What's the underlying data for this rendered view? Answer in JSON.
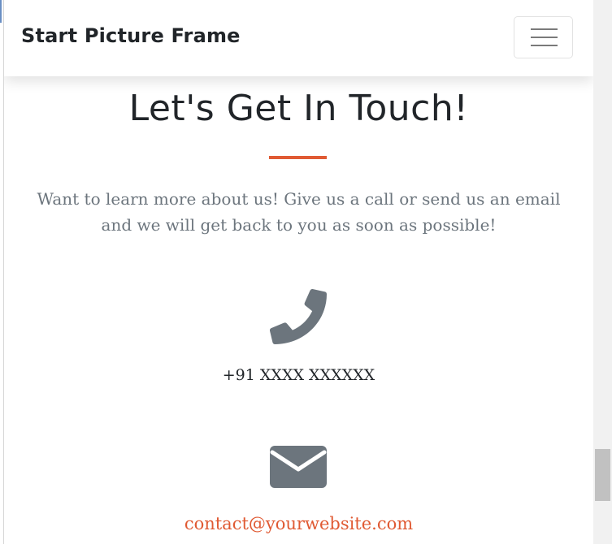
{
  "navbar": {
    "brand": "Start Picture Frame",
    "toggle_icon": "hamburger-menu-icon"
  },
  "contact": {
    "title": "Let's Get In Touch!",
    "lead": "Want to learn more about us! Give us a call or send us an email and we will get back to you as soon as possible!",
    "phone": {
      "icon": "phone-icon",
      "number": "+91 XXXX XXXXXX"
    },
    "email": {
      "icon": "envelope-icon",
      "address": "contact@yourwebsite.com"
    }
  },
  "colors": {
    "primary": "#e05a33",
    "muted": "#6c757d",
    "dark": "#212529"
  }
}
